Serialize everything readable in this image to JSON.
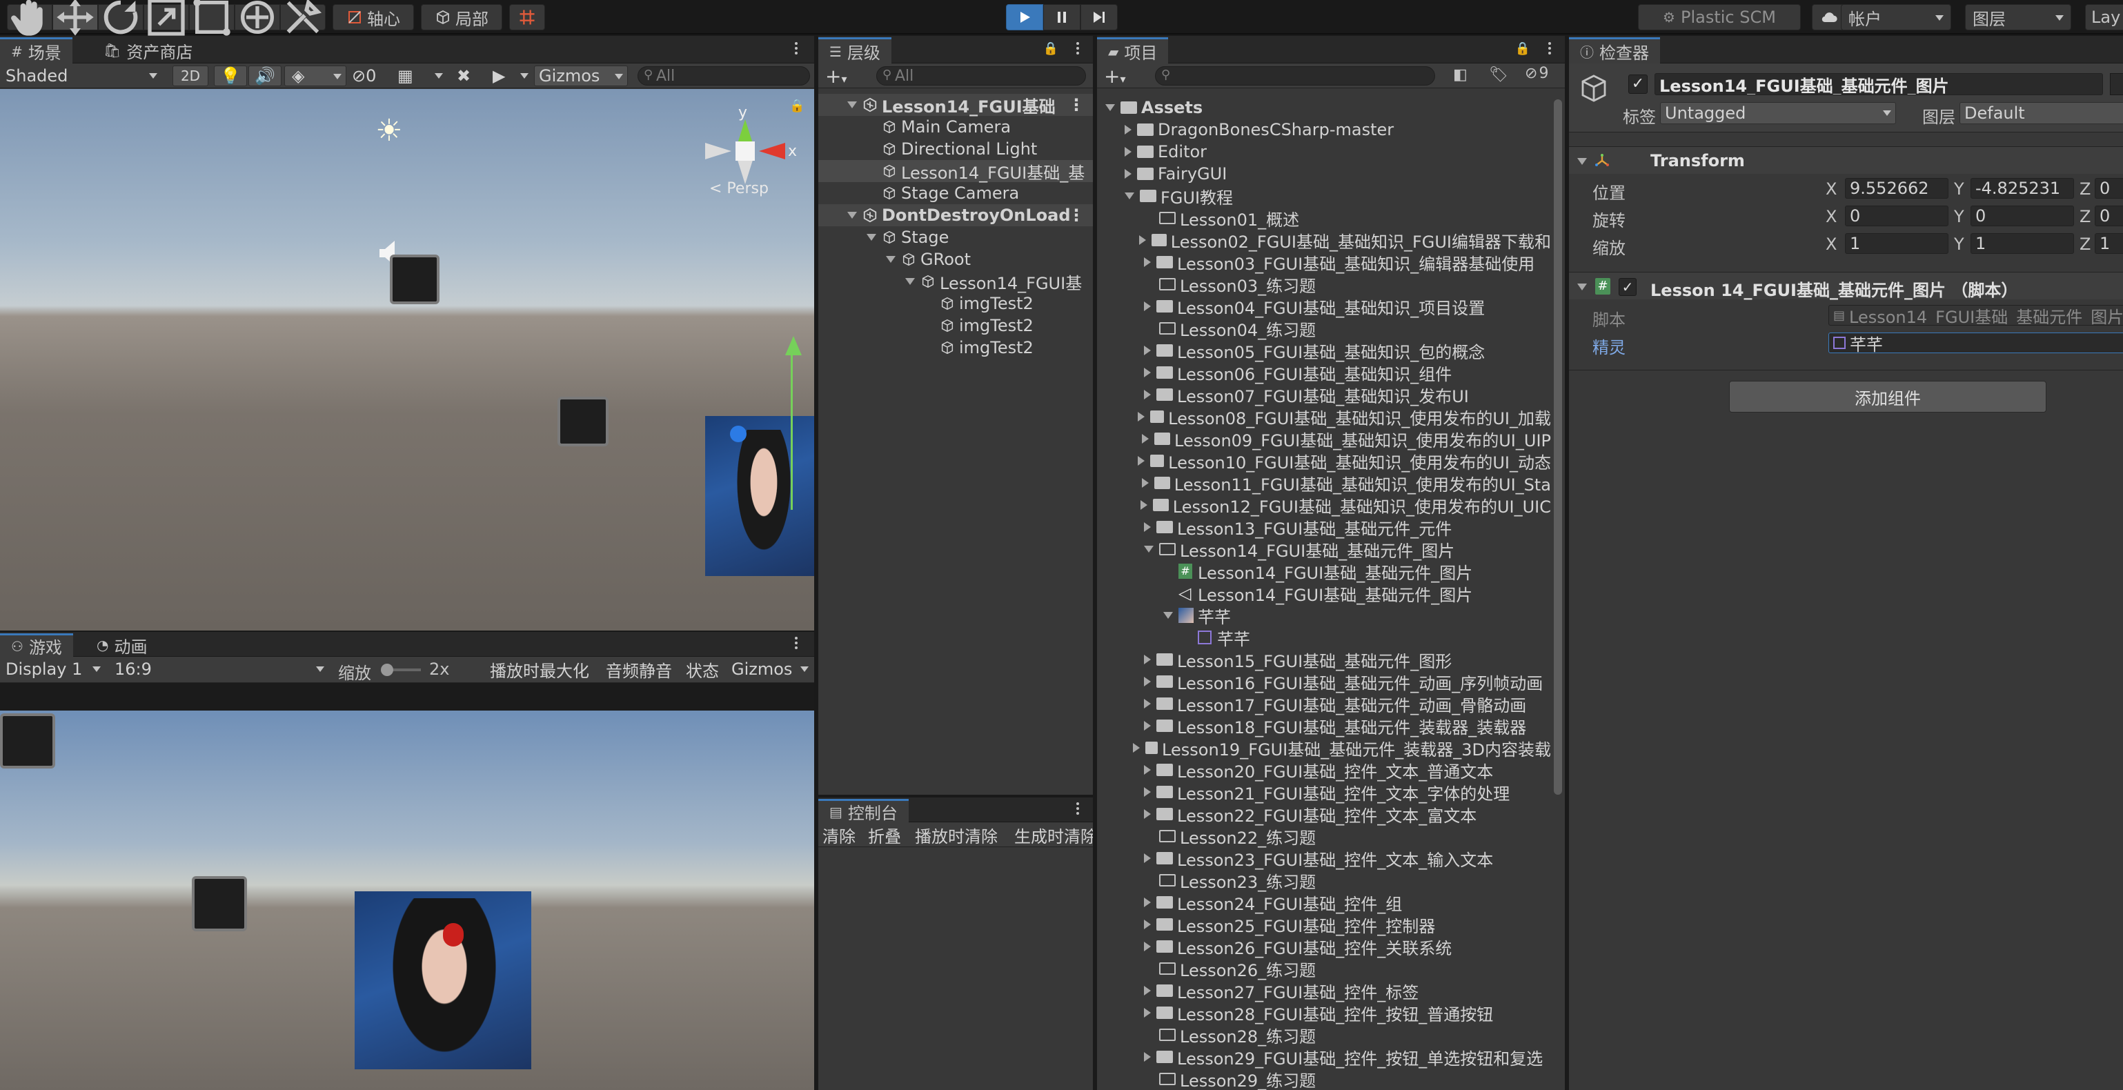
{
  "toolbar": {
    "pivot_label": "轴心",
    "local_label": "局部",
    "plastic_label": "Plastic SCM",
    "account_label": "帐户",
    "layers_label": "图层",
    "layout_label": "Lay"
  },
  "scene": {
    "tab_scene": "场景",
    "tab_assetstore": "资产商店",
    "shading": "Shaded",
    "mode_2d": "2D",
    "hidden_count": "0",
    "gizmos": "Gizmos",
    "search_placeholder": "All",
    "axis_y": "y",
    "axis_x": "x",
    "persp": "< Persp"
  },
  "game": {
    "tab_game": "游戏",
    "tab_animation": "动画",
    "display": "Display 1",
    "aspect": "16:9",
    "scale_label": "缩放",
    "scale_value": "2x",
    "maximize": "播放时最大化",
    "mute": "音频静音",
    "stats": "状态",
    "gizmos": "Gizmos"
  },
  "hierarchy": {
    "tab": "层级",
    "search_placeholder": "All",
    "items": [
      {
        "label": "Lesson14_FGUI基础",
        "indent": 0,
        "type": "scene",
        "expanded": true
      },
      {
        "label": "Main Camera",
        "indent": 1,
        "type": "go"
      },
      {
        "label": "Directional Light",
        "indent": 1,
        "type": "go"
      },
      {
        "label": "Lesson14_FGUI基础_基",
        "indent": 1,
        "type": "go",
        "selected": true
      },
      {
        "label": "Stage Camera",
        "indent": 1,
        "type": "go"
      },
      {
        "label": "DontDestroyOnLoad",
        "indent": 0,
        "type": "scene",
        "expanded": true
      },
      {
        "label": "Stage",
        "indent": 1,
        "type": "go",
        "expanded": true
      },
      {
        "label": "GRoot",
        "indent": 2,
        "type": "go",
        "expanded": true
      },
      {
        "label": "Lesson14_FGUI基",
        "indent": 3,
        "type": "go",
        "expanded": true
      },
      {
        "label": "imgTest2",
        "indent": 4,
        "type": "go"
      },
      {
        "label": "imgTest2",
        "indent": 4,
        "type": "go"
      },
      {
        "label": "imgTest2",
        "indent": 4,
        "type": "go"
      }
    ]
  },
  "console": {
    "tab": "控制台",
    "clear": "清除",
    "collapse": "折叠",
    "clear_on_play": "播放时清除",
    "clear_on_build": "生成时清除"
  },
  "project": {
    "tab": "项目",
    "hidden_count": "9",
    "items": [
      {
        "label": "Assets",
        "indent": 0,
        "kind": "folder",
        "arrow": "down"
      },
      {
        "label": "DragonBonesCSharp-master",
        "indent": 1,
        "kind": "folder",
        "arrow": "right"
      },
      {
        "label": "Editor",
        "indent": 1,
        "kind": "folder",
        "arrow": "right"
      },
      {
        "label": "FairyGUI",
        "indent": 1,
        "kind": "folder",
        "arrow": "right"
      },
      {
        "label": "FGUI教程",
        "indent": 1,
        "kind": "folder",
        "arrow": "down"
      },
      {
        "label": "Lesson01_概述",
        "indent": 2,
        "kind": "empty",
        "arrow": "none"
      },
      {
        "label": "Lesson02_FGUI基础_基础知识_FGUI编辑器下载和",
        "indent": 2,
        "kind": "folder",
        "arrow": "right"
      },
      {
        "label": "Lesson03_FGUI基础_基础知识_编辑器基础使用",
        "indent": 2,
        "kind": "folder",
        "arrow": "right"
      },
      {
        "label": "Lesson03_练习题",
        "indent": 2,
        "kind": "empty",
        "arrow": "none"
      },
      {
        "label": "Lesson04_FGUI基础_基础知识_项目设置",
        "indent": 2,
        "kind": "folder",
        "arrow": "right"
      },
      {
        "label": "Lesson04_练习题",
        "indent": 2,
        "kind": "empty",
        "arrow": "none"
      },
      {
        "label": "Lesson05_FGUI基础_基础知识_包的概念",
        "indent": 2,
        "kind": "folder",
        "arrow": "right"
      },
      {
        "label": "Lesson06_FGUI基础_基础知识_组件",
        "indent": 2,
        "kind": "folder",
        "arrow": "right"
      },
      {
        "label": "Lesson07_FGUI基础_基础知识_发布UI",
        "indent": 2,
        "kind": "folder",
        "arrow": "right"
      },
      {
        "label": "Lesson08_FGUI基础_基础知识_使用发布的UI_加载",
        "indent": 2,
        "kind": "folder",
        "arrow": "right"
      },
      {
        "label": "Lesson09_FGUI基础_基础知识_使用发布的UI_UIP",
        "indent": 2,
        "kind": "folder",
        "arrow": "right"
      },
      {
        "label": "Lesson10_FGUI基础_基础知识_使用发布的UI_动态",
        "indent": 2,
        "kind": "folder",
        "arrow": "right"
      },
      {
        "label": "Lesson11_FGUI基础_基础知识_使用发布的UI_Sta",
        "indent": 2,
        "kind": "folder",
        "arrow": "right"
      },
      {
        "label": "Lesson12_FGUI基础_基础知识_使用发布的UI_UIC",
        "indent": 2,
        "kind": "folder",
        "arrow": "right"
      },
      {
        "label": "Lesson13_FGUI基础_基础元件_元件",
        "indent": 2,
        "kind": "folder",
        "arrow": "right"
      },
      {
        "label": "Lesson14_FGUI基础_基础元件_图片",
        "indent": 2,
        "kind": "open",
        "arrow": "down"
      },
      {
        "label": "Lesson14_FGUI基础_基础元件_图片",
        "indent": 3,
        "kind": "script",
        "arrow": "none"
      },
      {
        "label": "Lesson14_FGUI基础_基础元件_图片",
        "indent": 3,
        "kind": "unity",
        "arrow": "none"
      },
      {
        "label": "芊芊",
        "indent": 3,
        "kind": "texture",
        "arrow": "down"
      },
      {
        "label": "芊芊",
        "indent": 4,
        "kind": "sprite",
        "arrow": "none"
      },
      {
        "label": "Lesson15_FGUI基础_基础元件_图形",
        "indent": 2,
        "kind": "folder",
        "arrow": "right"
      },
      {
        "label": "Lesson16_FGUI基础_基础元件_动画_序列帧动画",
        "indent": 2,
        "kind": "folder",
        "arrow": "right"
      },
      {
        "label": "Lesson17_FGUI基础_基础元件_动画_骨骼动画",
        "indent": 2,
        "kind": "folder",
        "arrow": "right"
      },
      {
        "label": "Lesson18_FGUI基础_基础元件_装载器_装载器",
        "indent": 2,
        "kind": "folder",
        "arrow": "right"
      },
      {
        "label": "Lesson19_FGUI基础_基础元件_装载器_3D内容装载",
        "indent": 2,
        "kind": "folder",
        "arrow": "right"
      },
      {
        "label": "Lesson20_FGUI基础_控件_文本_普通文本",
        "indent": 2,
        "kind": "folder",
        "arrow": "right"
      },
      {
        "label": "Lesson21_FGUI基础_控件_文本_字体的处理",
        "indent": 2,
        "kind": "folder",
        "arrow": "right"
      },
      {
        "label": "Lesson22_FGUI基础_控件_文本_富文本",
        "indent": 2,
        "kind": "folder",
        "arrow": "right"
      },
      {
        "label": "Lesson22_练习题",
        "indent": 2,
        "kind": "empty",
        "arrow": "none"
      },
      {
        "label": "Lesson23_FGUI基础_控件_文本_输入文本",
        "indent": 2,
        "kind": "folder",
        "arrow": "right"
      },
      {
        "label": "Lesson23_练习题",
        "indent": 2,
        "kind": "empty",
        "arrow": "none"
      },
      {
        "label": "Lesson24_FGUI基础_控件_组",
        "indent": 2,
        "kind": "folder",
        "arrow": "right"
      },
      {
        "label": "Lesson25_FGUI基础_控件_控制器",
        "indent": 2,
        "kind": "folder",
        "arrow": "right"
      },
      {
        "label": "Lesson26_FGUI基础_控件_关联系统",
        "indent": 2,
        "kind": "folder",
        "arrow": "right"
      },
      {
        "label": "Lesson26_练习题",
        "indent": 2,
        "kind": "empty",
        "arrow": "none"
      },
      {
        "label": "Lesson27_FGUI基础_控件_标签",
        "indent": 2,
        "kind": "folder",
        "arrow": "right"
      },
      {
        "label": "Lesson28_FGUI基础_控件_按钮_普通按钮",
        "indent": 2,
        "kind": "folder",
        "arrow": "right"
      },
      {
        "label": "Lesson28_练习题",
        "indent": 2,
        "kind": "empty",
        "arrow": "none"
      },
      {
        "label": "Lesson29_FGUI基础_控件_按钮_单选按钮和复选",
        "indent": 2,
        "kind": "folder",
        "arrow": "right"
      },
      {
        "label": "Lesson29_练习题",
        "indent": 2,
        "kind": "empty",
        "arrow": "none"
      }
    ]
  },
  "inspector": {
    "tab": "检查器",
    "object_name": "Lesson14_FGUI基础_基础元件_图片",
    "tag_label": "标签",
    "tag_value": "Untagged",
    "layer_label": "图层",
    "layer_value": "Default",
    "transform_title": "Transform",
    "position_label": "位置",
    "rotation_label": "旋转",
    "scale_label": "缩放",
    "pos": {
      "x": "9.552662",
      "y": "-4.825231",
      "z": "0"
    },
    "rot": {
      "x": "0",
      "y": "0",
      "z": "0"
    },
    "scl": {
      "x": "1",
      "y": "1",
      "z": "1"
    },
    "axis_x": "X",
    "axis_y": "Y",
    "axis_z": "Z",
    "script_title": "Lesson 14_FGUI基础_基础元件_图片 （脚本）",
    "script_label": "脚本",
    "script_value": "Lesson14_FGUI基础_基础元件_图片",
    "sprite_label": "精灵",
    "sprite_value": "芊芊",
    "add_component": "添加组件"
  }
}
